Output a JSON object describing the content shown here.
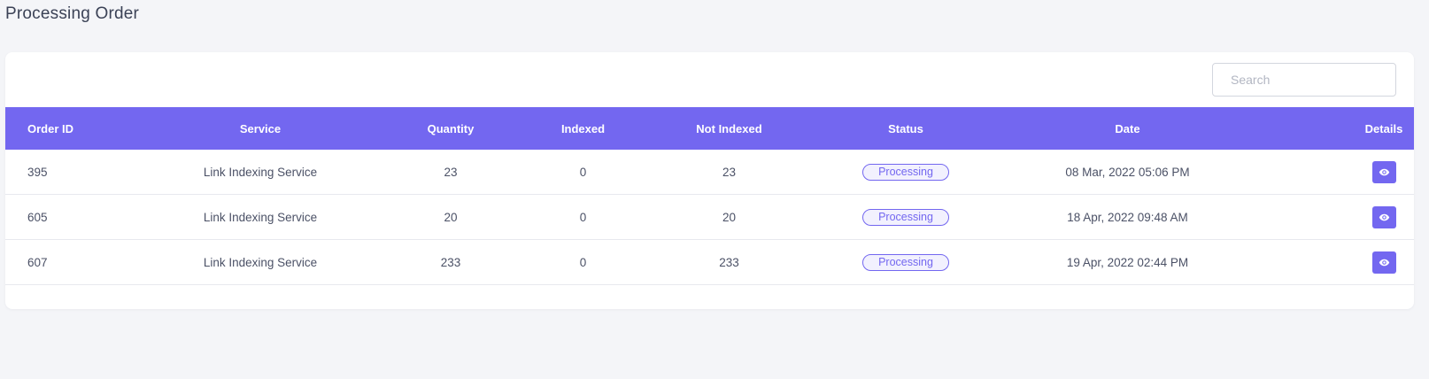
{
  "page": {
    "title": "Processing Order"
  },
  "search": {
    "placeholder": "Search",
    "value": ""
  },
  "table": {
    "headers": {
      "order_id": "Order ID",
      "service": "Service",
      "quantity": "Quantity",
      "indexed": "Indexed",
      "not_indexed": "Not Indexed",
      "status": "Status",
      "date": "Date",
      "details": "Details"
    },
    "rows": [
      {
        "order_id": "395",
        "service": "Link Indexing Service",
        "quantity": "23",
        "indexed": "0",
        "not_indexed": "23",
        "status": "Processing",
        "date": "08 Mar, 2022 05:06 PM",
        "details_icon": "eye-icon"
      },
      {
        "order_id": "605",
        "service": "Link Indexing Service",
        "quantity": "20",
        "indexed": "0",
        "not_indexed": "20",
        "status": "Processing",
        "date": "18 Apr, 2022 09:48 AM",
        "details_icon": "eye-icon"
      },
      {
        "order_id": "607",
        "service": "Link Indexing Service",
        "quantity": "233",
        "indexed": "0",
        "not_indexed": "233",
        "status": "Processing",
        "date": "19 Apr, 2022 02:44 PM",
        "details_icon": "eye-icon"
      }
    ]
  },
  "colors": {
    "accent": "#7367f0",
    "background": "#f4f5f8",
    "card": "#ffffff",
    "text": "#4b5166"
  }
}
